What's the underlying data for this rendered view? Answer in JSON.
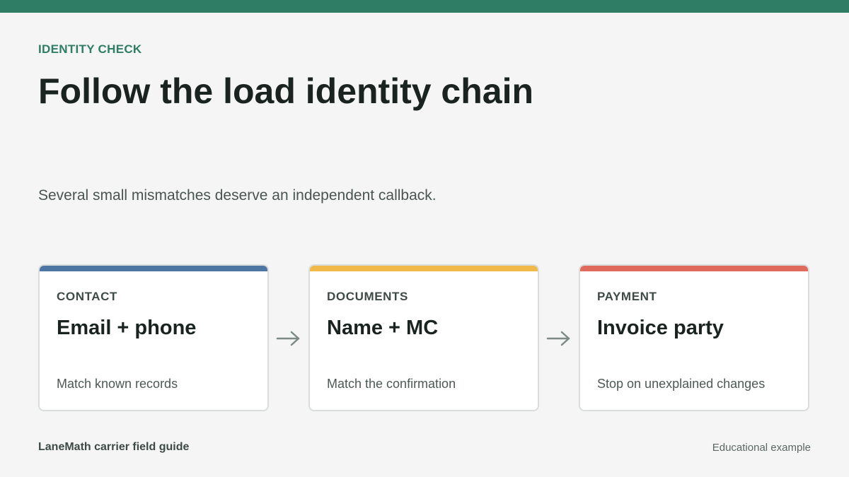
{
  "header": {
    "eyebrow": "IDENTITY CHECK",
    "title": "Follow the load identity chain",
    "subtitle": "Several small mismatches deserve an independent callback."
  },
  "steps": [
    {
      "kicker": "CONTACT",
      "heading": "Email + phone",
      "note": "Match known records",
      "accent_color": "#4e76a3"
    },
    {
      "kicker": "DOCUMENTS",
      "heading": "Name + MC",
      "note": "Match the confirmation",
      "accent_color": "#f0b94a"
    },
    {
      "kicker": "PAYMENT",
      "heading": "Invoice party",
      "note": "Stop on unexplained changes",
      "accent_color": "#e06a5c"
    }
  ],
  "arrow_icon": "arrow-right-icon",
  "footer": {
    "brand": "LaneMath carrier field guide",
    "note": "Educational example"
  },
  "colors": {
    "brand_green": "#2e7d64",
    "background": "#f4f5f4"
  }
}
